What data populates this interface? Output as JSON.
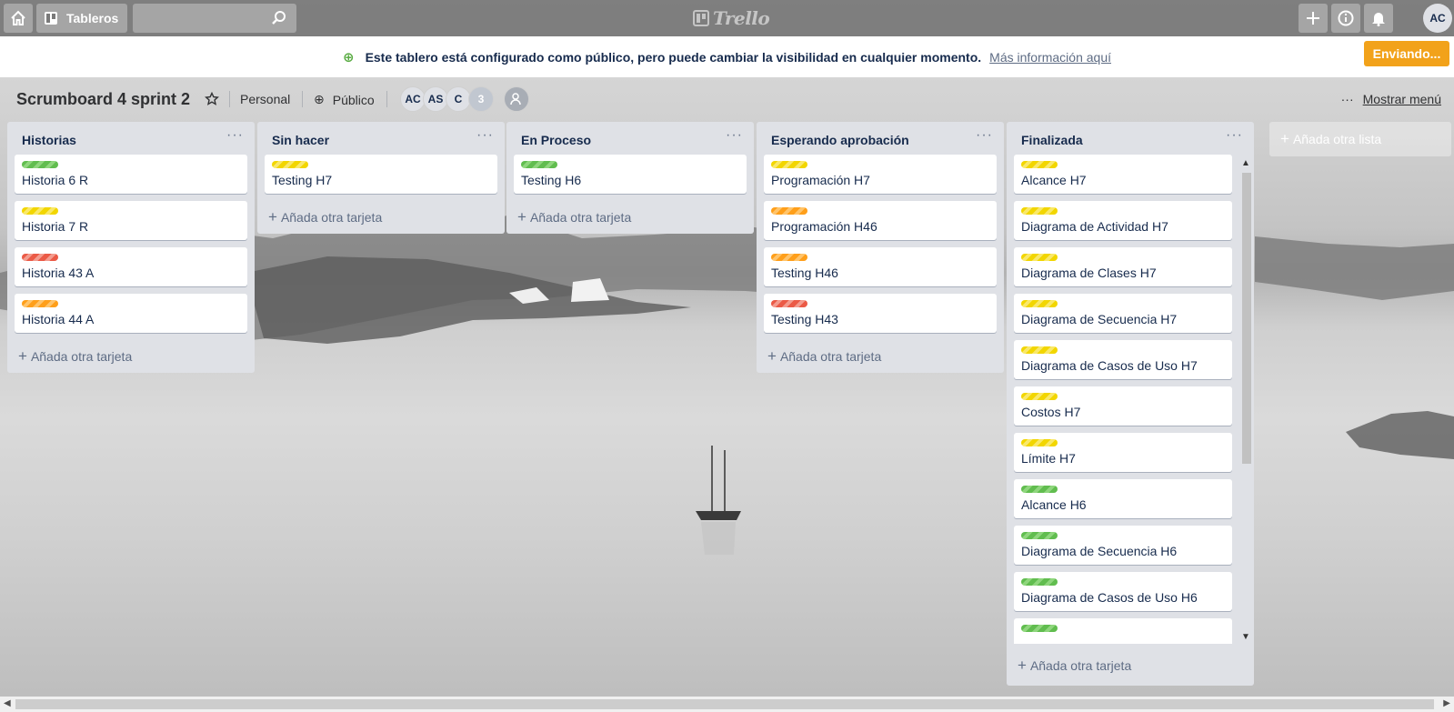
{
  "topbar": {
    "boards_label": "Tableros",
    "search_value": "",
    "logo_text": "Trello",
    "user_initials": "AC"
  },
  "banner": {
    "message": "Este tablero está configurado como público, pero puede cambiar la visibilidad en cualquier momento.",
    "link": "Más información aquí",
    "button": "Enviando..."
  },
  "board": {
    "title": "Scrumboard 4 sprint 2",
    "team": "Personal",
    "visibility": "Público",
    "members": [
      "AC",
      "AS",
      "C"
    ],
    "extra_members": "3",
    "menu_label": "Mostrar menú"
  },
  "colors": {
    "green": "#61bd4f",
    "yellow": "#f2d600",
    "orange": "#ff9f1a",
    "red": "#eb5a46",
    "banner_button": "#f2a21a"
  },
  "lists": [
    {
      "title": "Historias",
      "add_label": "Añada otra tarjeta",
      "cards": [
        {
          "label": "green",
          "title": "Historia 6 R"
        },
        {
          "label": "yellow",
          "title": "Historia 7 R"
        },
        {
          "label": "red",
          "title": "Historia 43 A"
        },
        {
          "label": "orange",
          "title": "Historia 44 A"
        }
      ]
    },
    {
      "title": "Sin hacer",
      "add_label": "Añada otra tarjeta",
      "cards": [
        {
          "label": "yellow",
          "title": "Testing H7"
        }
      ]
    },
    {
      "title": "En Proceso",
      "add_label": "Añada otra tarjeta",
      "cards": [
        {
          "label": "green",
          "title": "Testing H6"
        }
      ]
    },
    {
      "title": "Esperando aprobación",
      "add_label": "Añada otra tarjeta",
      "cards": [
        {
          "label": "yellow",
          "title": "Programación H7"
        },
        {
          "label": "orange",
          "title": "Programación H46"
        },
        {
          "label": "orange",
          "title": "Testing H46"
        },
        {
          "label": "red",
          "title": "Testing H43"
        }
      ]
    },
    {
      "title": "Finalizada",
      "add_label": "Añada otra tarjeta",
      "cards": [
        {
          "label": "yellow",
          "title": "Alcance H7"
        },
        {
          "label": "yellow",
          "title": "Diagrama de Actividad H7"
        },
        {
          "label": "yellow",
          "title": "Diagrama de Clases H7"
        },
        {
          "label": "yellow",
          "title": "Diagrama de Secuencia H7"
        },
        {
          "label": "yellow",
          "title": "Diagrama de Casos de Uso H7"
        },
        {
          "label": "yellow",
          "title": "Costos H7"
        },
        {
          "label": "yellow",
          "title": "Límite H7"
        },
        {
          "label": "green",
          "title": "Alcance H6"
        },
        {
          "label": "green",
          "title": "Diagrama de Secuencia H6"
        },
        {
          "label": "green",
          "title": "Diagrama de Casos de Uso H6"
        },
        {
          "label": "green",
          "title": ""
        }
      ]
    }
  ],
  "add_list_label": "Añada otra lista"
}
